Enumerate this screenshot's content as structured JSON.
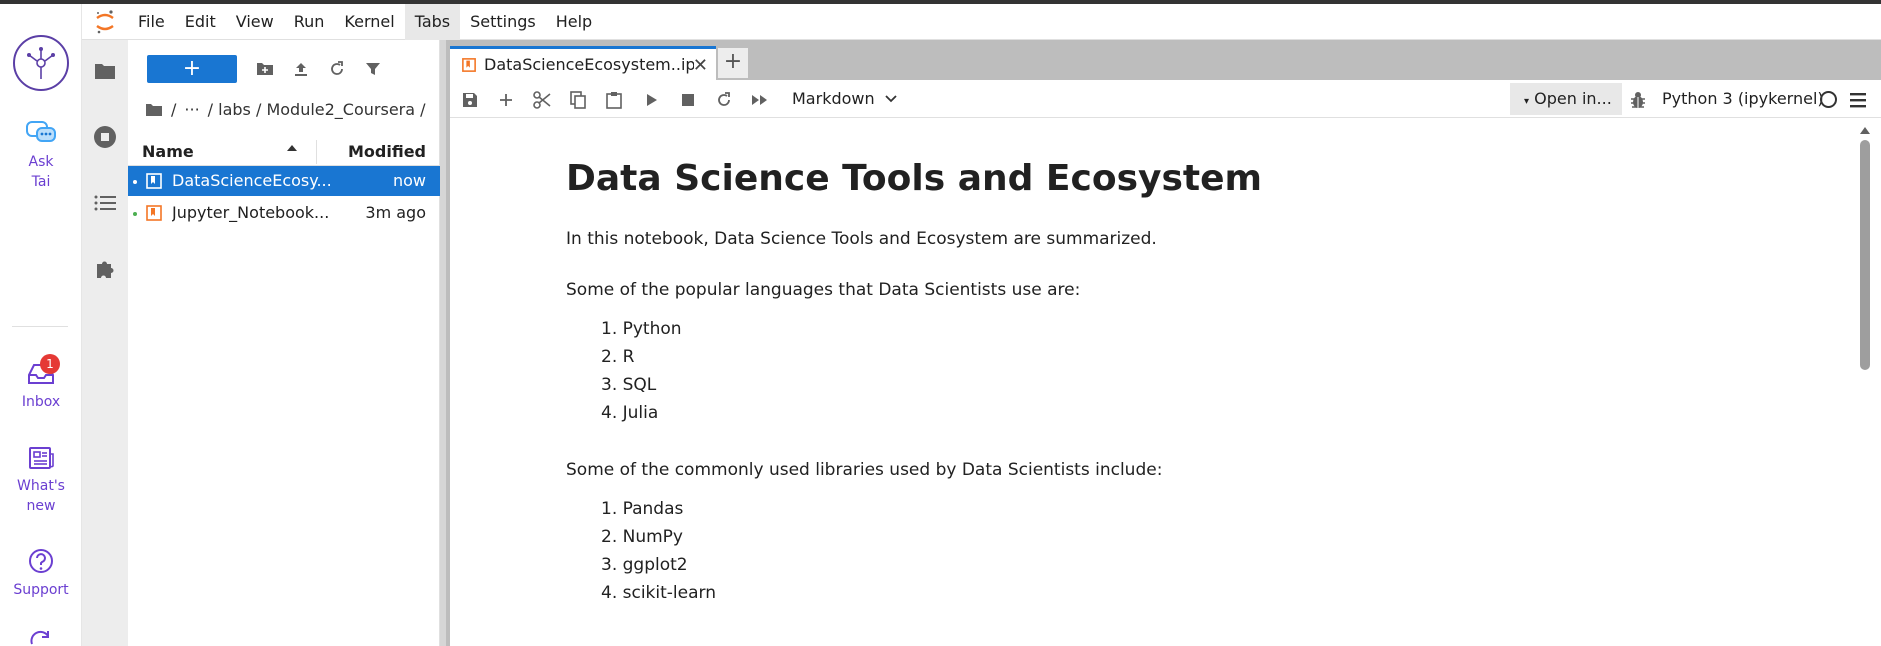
{
  "rail": {
    "items": [
      {
        "label_lines": [
          "Ask",
          "Tai"
        ]
      },
      {
        "label_lines": [
          "Inbox"
        ],
        "badge": "1"
      },
      {
        "label_lines": [
          "What's",
          "new"
        ]
      },
      {
        "label_lines": [
          "Support"
        ]
      }
    ]
  },
  "menubar": {
    "items": [
      "File",
      "Edit",
      "View",
      "Run",
      "Kernel",
      "Tabs",
      "Settings",
      "Help"
    ],
    "active": "Tabs"
  },
  "filebrowser": {
    "new_label": "+",
    "breadcrumb": [
      "/",
      "···",
      "/ labs / Module2_Coursera /"
    ],
    "columns": {
      "name": "Name",
      "modified": "Modified"
    },
    "files": [
      {
        "name": "DataScienceEcosy...",
        "modified": "now"
      },
      {
        "name": "Jupyter_Notebook...",
        "modified": "3m ago"
      }
    ]
  },
  "tabs": {
    "active_label": "DataScienceEcosystem..ipynb",
    "add_label": "+"
  },
  "notebook_toolbar": {
    "cell_type": "Markdown",
    "open_in": "Open in...",
    "kernel": "Python 3 (ipykernel)"
  },
  "document": {
    "title": "Data Science Tools and Ecosystem",
    "intro": "In this notebook, Data Science Tools and Ecosystem are summarized.",
    "languages_intro": "Some of the popular languages that Data Scientists use are:",
    "languages": [
      "1. Python",
      "2. R",
      "3. SQL",
      "4. Julia"
    ],
    "libraries_intro": "Some of the commonly used libraries used by Data Scientists include:",
    "libraries": [
      "1. Pandas",
      "2. NumPy",
      "3. ggplot2",
      "4. scikit-learn"
    ]
  },
  "colors": {
    "accent": "#1976d2",
    "rail_purple": "#6b3fd1",
    "jupyter_orange": "#f37626"
  }
}
